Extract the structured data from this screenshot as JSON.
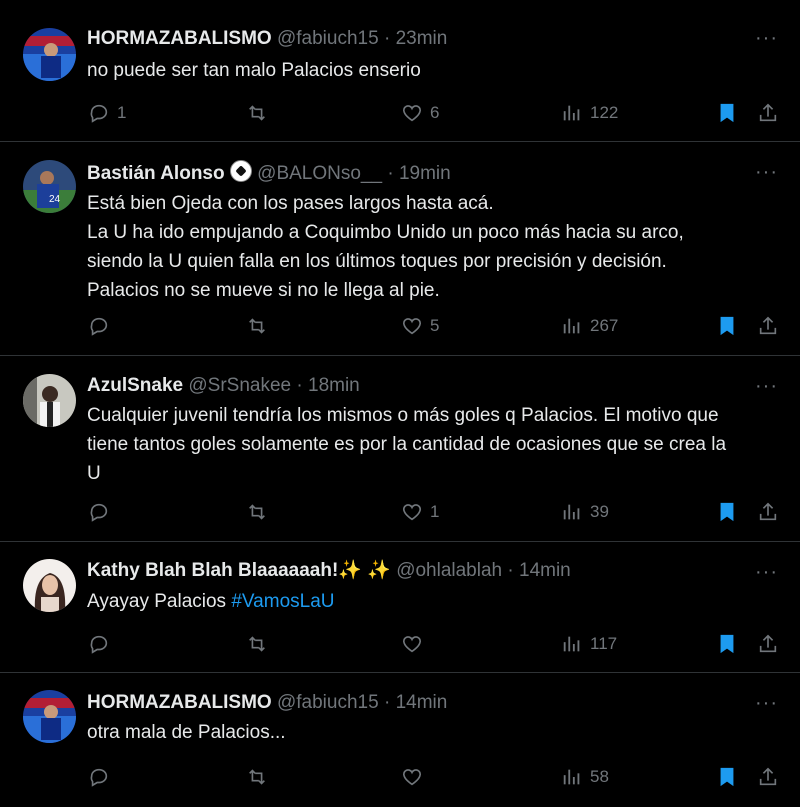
{
  "tweets": [
    {
      "name": "HORMAZABALISMO",
      "handle": "@fabiuch15",
      "time": "23min",
      "lines": [
        "no puede ser tan malo Palacios enserio"
      ],
      "replies": "1",
      "retweets": "",
      "likes": "6",
      "views": "122",
      "avatar": "blue-football-avatar"
    },
    {
      "name": "Bastián Alonso",
      "name_emoji": "soccer-ball",
      "handle": "@BALONso__",
      "time": "19min",
      "lines": [
        "Está bien Ojeda con los pases largos hasta acá.",
        "La U ha ido empujando a Coquimbo Unido un poco más hacia su arco,",
        "siendo la U quien falla en los últimos toques por precisión y decisión.",
        "Palacios no se mueve si no le llega al pie."
      ],
      "replies": "",
      "retweets": "",
      "likes": "5",
      "views": "267",
      "avatar": "player-avatar"
    },
    {
      "name": "AzulSnake",
      "handle": "@SrSnakee",
      "time": "18min",
      "lines": [
        "Cualquier juvenil tendría los mismos o más goles q Palacios. El motivo que",
        "tiene tantos goles solamente es por la cantidad de ocasiones que se crea la",
        "U"
      ],
      "replies": "",
      "retweets": "",
      "likes": "1",
      "views": "39",
      "avatar": "person-avatar"
    },
    {
      "name": "Kathy Blah Blah Blaaaaaah!",
      "name_emoji": "sparkles",
      "handle": "@ohlalablah",
      "time": "14min",
      "lines": [
        "Ayayay Palacios "
      ],
      "hashtag": "#VamosLaU",
      "replies": "",
      "retweets": "",
      "likes": "",
      "views": "117",
      "avatar": "woman-avatar"
    },
    {
      "name": "HORMAZABALISMO",
      "handle": "@fabiuch15",
      "time": "14min",
      "lines": [
        "otra mala de Palacios..."
      ],
      "replies": "",
      "retweets": "",
      "likes": "",
      "views": "58",
      "avatar": "blue-football-avatar"
    }
  ],
  "more_label": "···",
  "dot": "·",
  "colors": {
    "background": "#000000",
    "text": "#e7e9ea",
    "muted": "#71767b",
    "accent": "#1d9bf0",
    "divider": "#2f3336"
  }
}
